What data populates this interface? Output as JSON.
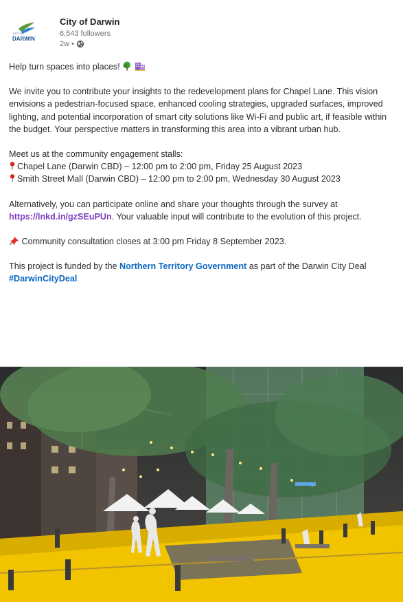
{
  "post": {
    "org_name": "City of Darwin",
    "followers": "6,543 followers",
    "time": "2w •",
    "logo_text": "CITY OF DARWIN",
    "intro": "Help turn spaces into places!",
    "description": "We invite you to contribute your insights to the redevelopment plans for Chapel Lane. This vision envisions a pedestrian-focused space, enhanced cooling strategies, upgraded surfaces, improved lighting, and potential incorporation of smart city solutions like Wi-Fi and public art, if feasible within the budget. Your perspective matters in transforming this area into a vibrant urban hub.",
    "meet_intro": "Meet us at the community engagement stalls:",
    "stalls": [
      "Chapel Lane (Darwin CBD) – 12:00 pm to 2:00 pm, Friday 25 August 2023",
      "Smith Street Mall (Darwin CBD) – 12:00 pm to 2:00 pm, Wednesday 30 August 2023"
    ],
    "online_before": "Alternatively, you can participate online and share your thoughts through the survey at ",
    "online_link": "https://lnkd.in/gzSEuPUn",
    "online_after": ". Your valuable input will contribute to the evolution of this project.",
    "closing": "Community consultation closes at 3:00 pm Friday 8 September 2023.",
    "funded_before": "This project is funded by the ",
    "funded_link": "Northern Territory Government",
    "funded_after": " as part of the Darwin City Deal ",
    "hashtag": "#DarwinCityDeal"
  },
  "icons": {
    "tree": "tree-emoji",
    "building": "building-emoji",
    "pin": "round-pushpin",
    "pushpin": "pushpin",
    "globe": "globe-icon"
  },
  "colors": {
    "link_blue": "#0a66c2",
    "link_purple": "#7b3fbf",
    "muted": "#6f6f6f",
    "plaza_yellow": "#f2c400"
  }
}
